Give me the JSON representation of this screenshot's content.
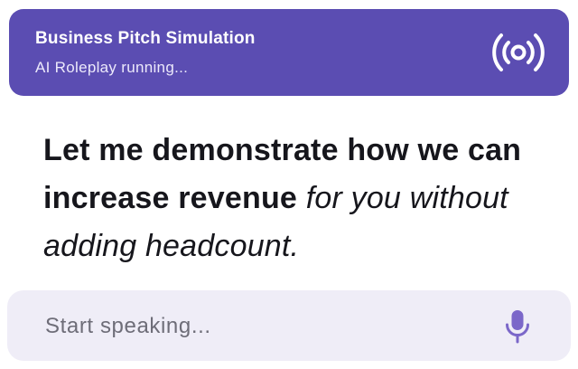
{
  "header": {
    "title": "Business Pitch Simulation",
    "status": "AI Roleplay running...",
    "live_icon": "broadcast-icon",
    "background_color": "#5b4db2"
  },
  "message": {
    "bold_text": "Let me demonstrate how we can increase revenue",
    "italic_text": "for you without adding headcount."
  },
  "input": {
    "placeholder": "Start speaking...",
    "value": "",
    "mic_icon": "microphone-icon",
    "accent_color": "#7b67c9"
  }
}
